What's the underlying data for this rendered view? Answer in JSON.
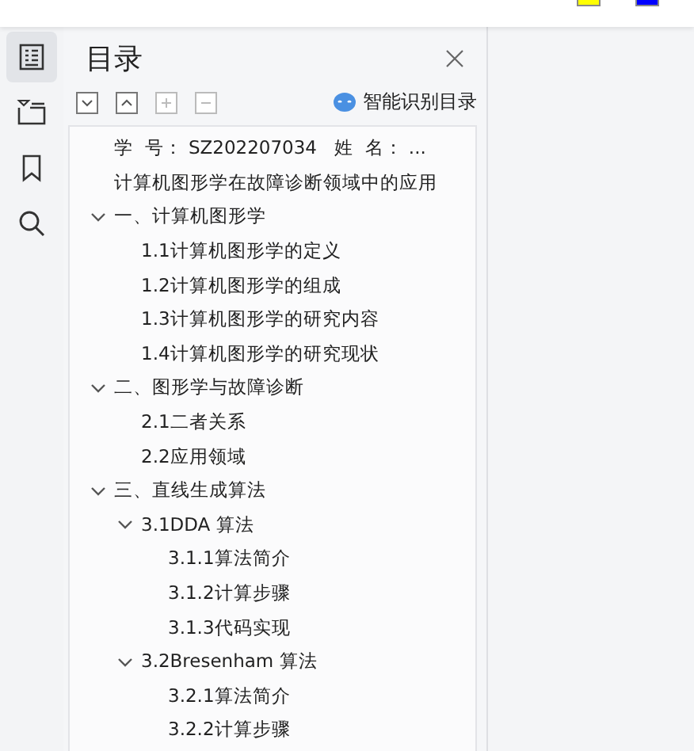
{
  "sidebar": {
    "items": [
      {
        "kind": "toc",
        "selected": true
      },
      {
        "kind": "outline",
        "selected": false
      },
      {
        "kind": "bookmark",
        "selected": false
      },
      {
        "kind": "search",
        "selected": false
      }
    ]
  },
  "toc_panel": {
    "title": "目录",
    "smart_button": "智能识别目录",
    "items": [
      {
        "label": "学  号： SZ202207034   姓  名： ..."
      },
      {
        "label": "计算机图形学在故障诊断领域中的应用"
      },
      {
        "label": "一、计算机图形学",
        "expanded": true,
        "children": [
          {
            "label": "1.1计算机图形学的定义"
          },
          {
            "label": "1.2计算机图形学的组成"
          },
          {
            "label": "1.3计算机图形学的研究内容"
          },
          {
            "label": "1.4计算机图形学的研究现状"
          }
        ]
      },
      {
        "label": "二、图形学与故障诊断",
        "expanded": true,
        "children": [
          {
            "label": "2.1二者关系"
          },
          {
            "label": "2.2应用领域"
          }
        ]
      },
      {
        "label": "三、直线生成算法",
        "expanded": true,
        "children": [
          {
            "label": "3.1DDA 算法",
            "expanded": true,
            "children": [
              {
                "label": "3.1.1算法简介"
              },
              {
                "label": "3.1.2计算步骤"
              },
              {
                "label": "3.1.3代码实现"
              }
            ]
          },
          {
            "label": "3.2Bresenham 算法",
            "expanded": true,
            "children": [
              {
                "label": "3.2.1算法简介"
              },
              {
                "label": "3.2.2计算步骤"
              }
            ]
          }
        ]
      }
    ]
  }
}
